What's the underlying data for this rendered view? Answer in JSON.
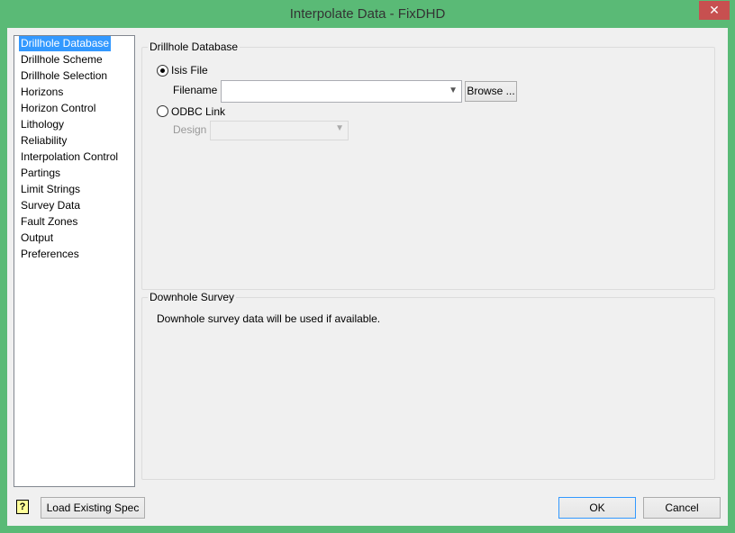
{
  "window": {
    "title": "Interpolate Data - FixDHD",
    "close": "✕"
  },
  "nav": [
    "Drillhole Database",
    "Drillhole Scheme",
    "Drillhole Selection",
    "Horizons",
    "Horizon Control",
    "Lithology",
    "Reliability",
    "Interpolation Control",
    "Partings",
    "Limit Strings",
    "Survey Data",
    "Fault Zones",
    "Output",
    "Preferences"
  ],
  "db": {
    "legend": "Drillhole Database",
    "isis": "Isis File",
    "filename_label": "Filename",
    "filename_value": "",
    "browse": "Browse ...",
    "odbc": "ODBC Link",
    "design_label": "Design",
    "design_value": ""
  },
  "survey": {
    "legend": "Downhole Survey",
    "text": "Downhole survey data will be used if available."
  },
  "footer": {
    "help": "?",
    "load": "Load Existing Spec",
    "ok": "OK",
    "cancel": "Cancel"
  }
}
